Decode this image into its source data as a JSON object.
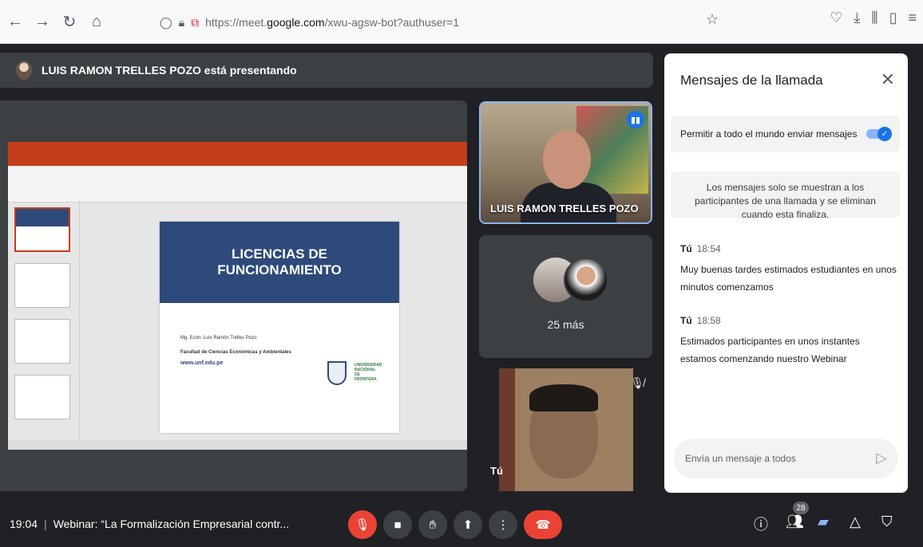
{
  "browser": {
    "url_prefix": "https://meet.",
    "url_domain": "google.com",
    "url_path": "/xwu-agsw-bot?authuser=1"
  },
  "meet": {
    "presenter_text": "LUIS RAMON TRELLES POZO está presentando",
    "slide": {
      "title": "LICENCIAS DE FUNCIONAMIENTO",
      "author": "Mg. Econ. Luis Ramón Trelles Pozo",
      "faculty": "Facultad de Ciencias Económicas y Ambientales",
      "website": "www.unf.edu.pe",
      "university": "UNIVERSIDAD NACIONAL DE FRONTERA"
    },
    "tiles": {
      "presenter_name": "LUIS RAMON TRELLES POZO",
      "more_label": "25 más",
      "you_label": "Tú"
    }
  },
  "chat": {
    "title": "Mensajes de la llamada",
    "allow_label": "Permitir a todo el mundo enviar mensajes",
    "allow_enabled": true,
    "info": "Los mensajes solo se muestran a los participantes de una llamada y se eliminan cuando esta finaliza.",
    "messages": [
      {
        "sender": "Tú",
        "time": "18:54",
        "text": "Muy buenas tardes estimados estudiantes en unos minutos comenzamos"
      },
      {
        "sender": "Tú",
        "time": "18:58",
        "text": "Estimados participantes en unos instantes estamos comenzando nuestro Webinar"
      }
    ],
    "input_placeholder": "Envía un mensaje a todos"
  },
  "toolbar": {
    "time": "19:04",
    "meeting_title": "Webinar: “La Formalización Empresarial contr...",
    "participant_count": "28"
  },
  "colors": {
    "accent": "#1a73e8",
    "end_call": "#ea4335",
    "background": "#202124"
  }
}
